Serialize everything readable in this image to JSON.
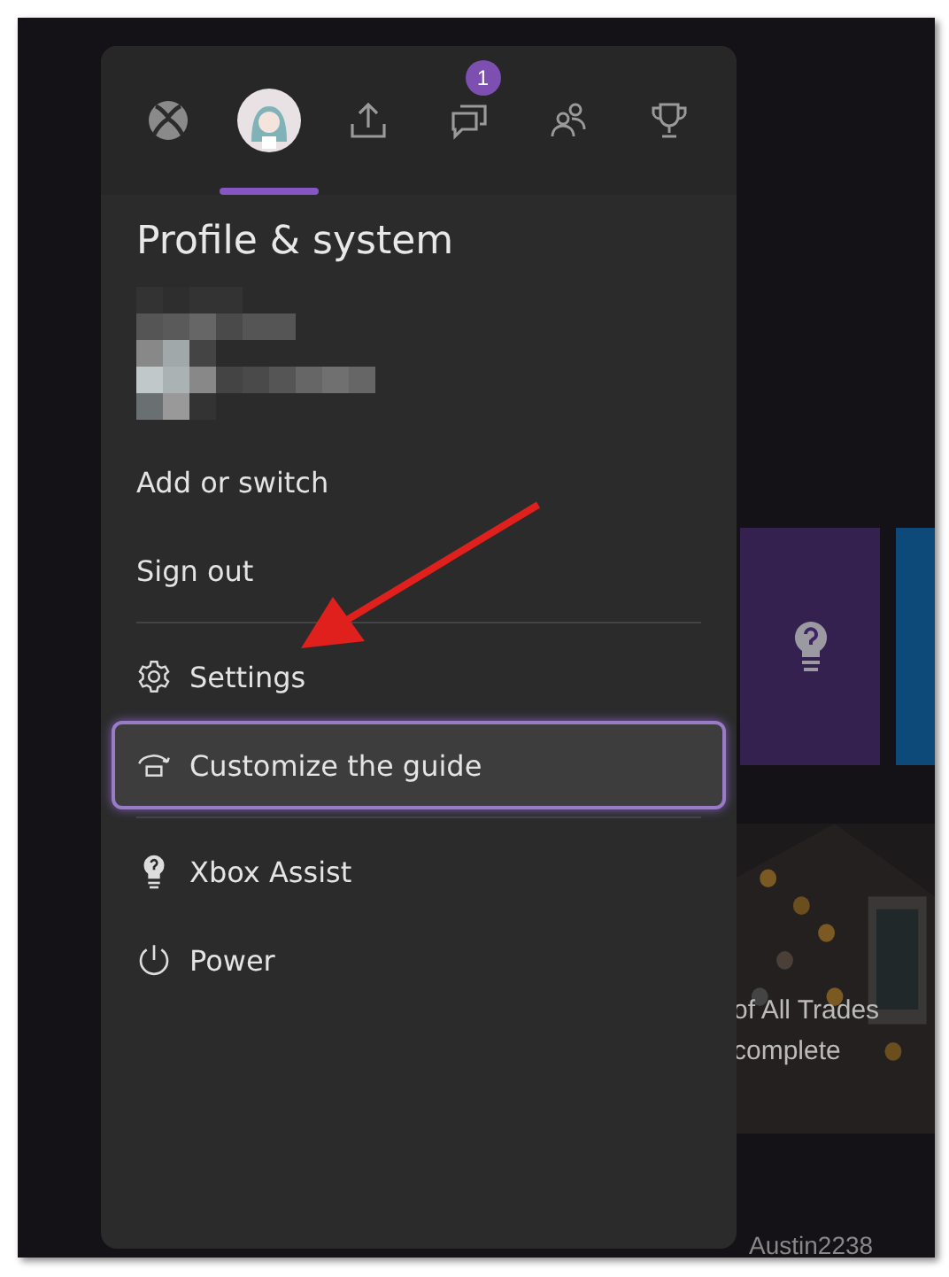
{
  "guide": {
    "tabs": [
      {
        "kind": "xbox",
        "selected": false
      },
      {
        "kind": "avatar",
        "selected": true
      },
      {
        "kind": "share",
        "selected": false
      },
      {
        "kind": "chat",
        "selected": false,
        "badge": "1"
      },
      {
        "kind": "people",
        "selected": false
      },
      {
        "kind": "trophy",
        "selected": false
      }
    ],
    "title": "Profile & system",
    "account_actions": [
      "Add or switch",
      "Sign out"
    ],
    "items": [
      {
        "kind": "settings",
        "label": "Settings",
        "focused": false
      },
      {
        "kind": "customize",
        "label": "Customize the guide",
        "focused": true
      },
      {
        "kind": "assist",
        "label": "Xbox Assist",
        "focused": false
      },
      {
        "kind": "power",
        "label": "Power",
        "focused": false
      }
    ]
  },
  "background": {
    "game_tile": {
      "lines": [
        "of All Trades",
        "complete"
      ]
    },
    "user": "Austin2238"
  }
}
